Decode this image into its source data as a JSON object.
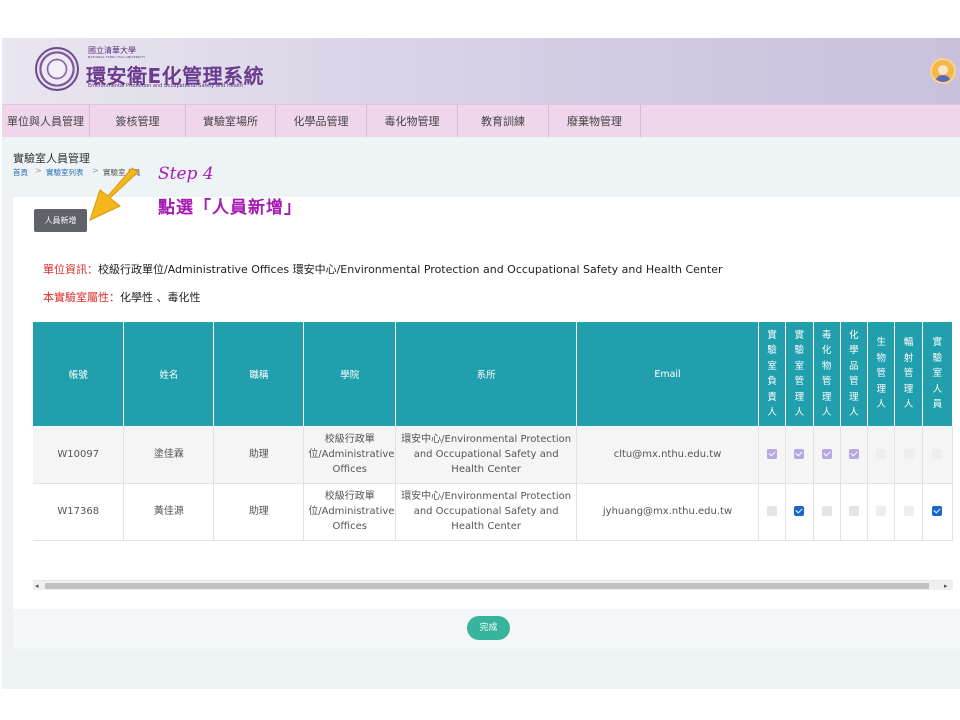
{
  "header": {
    "logo_line1": "國立清華大學",
    "logo_line2": "NATIONAL TSING HUA UNIVERSITY",
    "title": "環安衛E化管理系統",
    "subtitle": "Environmental Protection and Occupational Safety and Health"
  },
  "nav": [
    "單位與人員管理",
    "簽核管理",
    "實驗室場所",
    "化學品管理",
    "毒化物管理",
    "教育訓練",
    "廢棄物管理"
  ],
  "page": {
    "title": "實驗室人員管理",
    "breadcrumb": [
      "首頁",
      "實驗室列表",
      "實驗室人員"
    ]
  },
  "add_button": "人員新增",
  "annotation": {
    "step": "Step 4",
    "instruction": "點選「人員新增」"
  },
  "info": {
    "unit_label": "單位資訊：",
    "unit_value": "校級行政單位/Administrative Offices  環安中心/Environmental Protection and Occupational Safety and Health Center",
    "attr_label": "本實驗室屬性：",
    "attr_value": "化學性 、毒化性"
  },
  "table": {
    "headers": [
      "帳號",
      "姓名",
      "職稱",
      "學院",
      "系所",
      "Email",
      "實驗室負責人",
      "實驗室管理人",
      "毒化物管理人",
      "化學品管理人",
      "生物管理人",
      "輻射管理人",
      "實驗室人員"
    ],
    "rows": [
      {
        "account": "W10097",
        "name": "塗佳霖",
        "title": "助理",
        "college": "校級行政單位/Administrative Offices",
        "dept": "環安中心/Environmental Protection and Occupational Safety and Health Center",
        "email": "cltu@mx.nthu.edu.tw",
        "checks": [
          "on-dis",
          "on-dis",
          "on-dis",
          "on-dis",
          "off-light",
          "off-light",
          "off-light"
        ]
      },
      {
        "account": "W17368",
        "name": "黃佳源",
        "title": "助理",
        "college": "校級行政單位/Administrative Offices",
        "dept": "環安中心/Environmental Protection and Occupational Safety and Health Center",
        "email": "jyhuang@mx.nthu.edu.tw",
        "checks": [
          "off",
          "on",
          "off",
          "off",
          "off-light",
          "off-light",
          "on"
        ]
      }
    ]
  },
  "done_button": "完成"
}
